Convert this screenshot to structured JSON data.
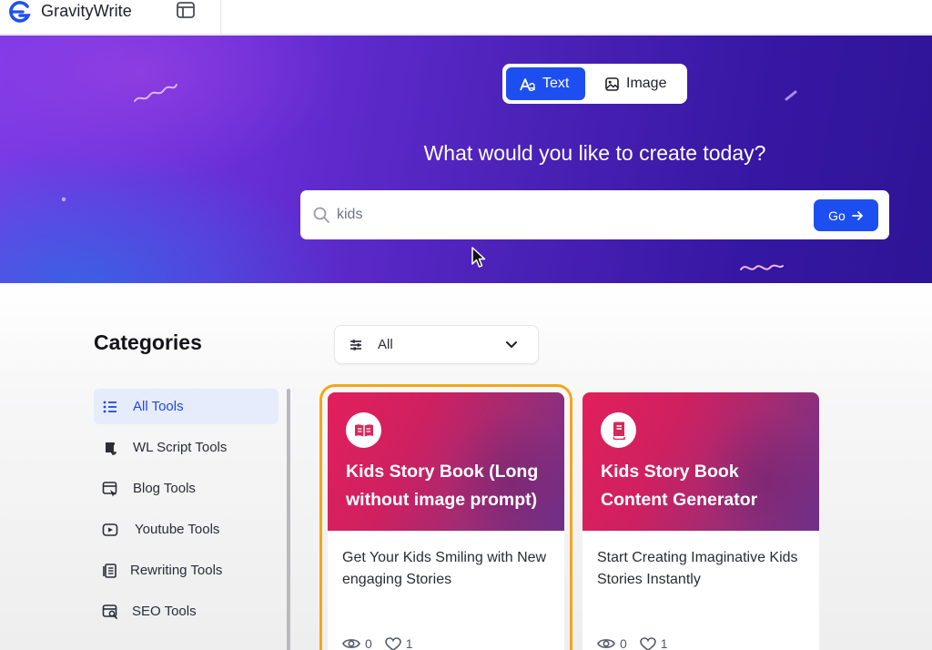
{
  "app": {
    "brand": "GravityWrite"
  },
  "hero": {
    "modes": [
      {
        "label": "Text",
        "active": true
      },
      {
        "label": "Image",
        "active": false
      }
    ],
    "title": "What would you like to create today?",
    "search": {
      "value": "kids",
      "go_label": "Go"
    }
  },
  "sidebar": {
    "title": "Categories",
    "items": [
      {
        "label": "All Tools",
        "icon": "list-icon",
        "active": true
      },
      {
        "label": "WL Script Tools",
        "icon": "script-icon",
        "active": false
      },
      {
        "label": "Blog Tools",
        "icon": "blog-icon",
        "active": false
      },
      {
        "label": "Youtube Tools",
        "icon": "youtube-icon",
        "active": false
      },
      {
        "label": "Rewriting Tools",
        "icon": "rewrite-icon",
        "active": false
      },
      {
        "label": "SEO Tools",
        "icon": "seo-icon",
        "active": false
      }
    ]
  },
  "filter": {
    "selected": "All"
  },
  "cards": [
    {
      "title": "Kids Story Book (Long without image prompt)",
      "description": "Get Your Kids Smiling with New engaging Stories",
      "views": "0",
      "likes": "1",
      "icon": "open-book-icon",
      "selected": true
    },
    {
      "title": "Kids Story Book Content Generator",
      "description": "Start Creating Imaginative Kids Stories Instantly",
      "views": "0",
      "likes": "1",
      "icon": "book-icon",
      "selected": false
    }
  ],
  "colors": {
    "accent": "#1d4ff0",
    "card_gradient_start": "#e21f5c",
    "card_gradient_end": "#6d2f8a",
    "selection_outline": "#f2a61c",
    "hero_gradient_start": "#7c3ae6",
    "hero_gradient_end": "#2e1496"
  }
}
